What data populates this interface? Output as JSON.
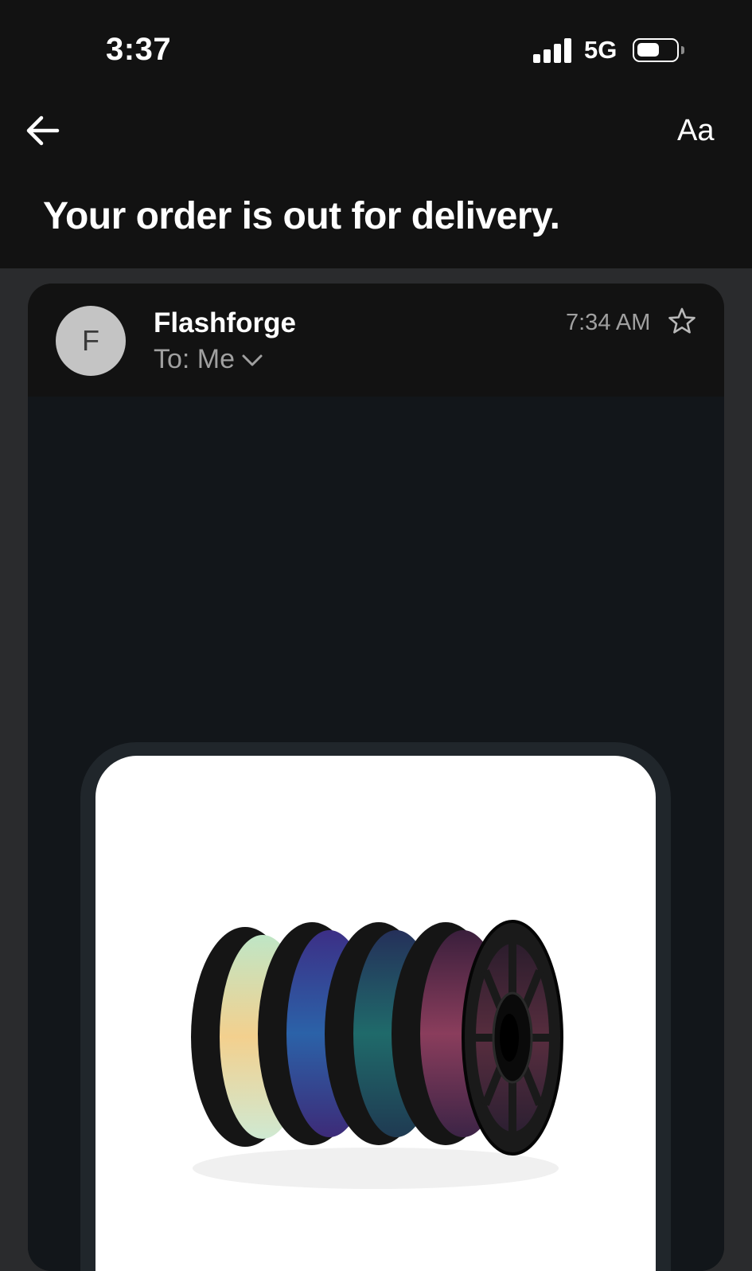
{
  "status_bar": {
    "time": "3:37",
    "network": "5G",
    "signal_icon": "signal-bars-icon",
    "battery_icon": "battery-icon"
  },
  "toolbar": {
    "back_icon": "back-arrow-icon",
    "text_size_label": "Aa"
  },
  "email": {
    "subject": "Your order is out for delivery.",
    "sender_initial": "F",
    "sender_name": "Flashforge",
    "recipient_label": "To: Me",
    "time": "7:34 AM",
    "star_icon": "star-outline-icon",
    "image_subject": "filament-spools"
  },
  "colors": {
    "background": "#121212",
    "email_body": "#12161a",
    "avatar": "#c4c4c4",
    "secondary_text": "#a0a0a0"
  }
}
